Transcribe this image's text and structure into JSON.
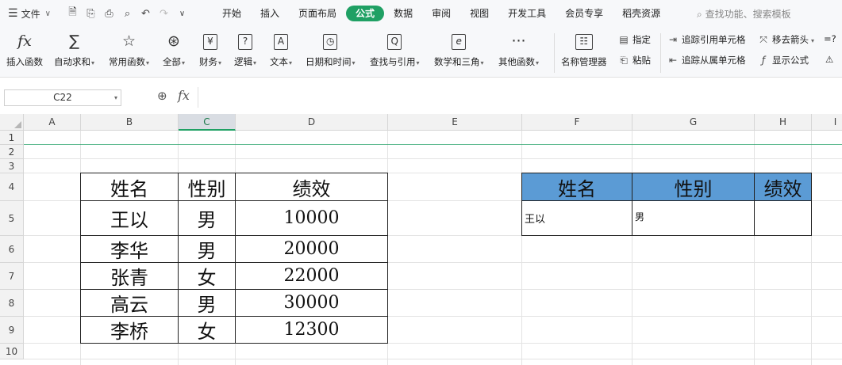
{
  "menubar": {
    "file_label": "文件",
    "tabs": [
      "开始",
      "插入",
      "页面布局",
      "公式",
      "数据",
      "审阅",
      "视图",
      "开发工具",
      "会员专享",
      "稻壳资源"
    ],
    "active_tab": "公式",
    "search_placeholder": "查找功能、搜索模板"
  },
  "ribbon": {
    "insert_function": "插入函数",
    "autosum": "自动求和",
    "common_functions": "常用函数",
    "all": "全部",
    "finance": "财务",
    "logic": "逻辑",
    "text": "文本",
    "datetime": "日期和时间",
    "lookup": "查找与引用",
    "math": "数学和三角",
    "other": "其他函数",
    "name_manager": "名称管理器",
    "define": "指定",
    "paste": "粘贴",
    "trace_precedents": "追踪引用单元格",
    "trace_dependents": "追踪从属单元格",
    "remove_arrows": "移去箭头",
    "show_formulas": "显示公式",
    "icon_fx": "fx",
    "icon_sum": "∑",
    "icon_star": "☆",
    "icon_all": "⊛",
    "icon_yen": "¥",
    "icon_logic": "?",
    "icon_text": "A",
    "icon_clock": "◷",
    "icon_lookup": "Q",
    "icon_math": "e",
    "icon_more": "···"
  },
  "formula_bar": {
    "cell_ref": "C22",
    "formula": ""
  },
  "sheet": {
    "columns": [
      "A",
      "B",
      "C",
      "D",
      "E",
      "F",
      "G",
      "H",
      "I"
    ],
    "selected_column": "C",
    "rows": [
      "1",
      "2",
      "3",
      "4",
      "5",
      "6",
      "7",
      "8",
      "9",
      "10"
    ],
    "table1": {
      "headers": [
        "姓名",
        "性别",
        "绩效"
      ],
      "rows": [
        [
          "王以",
          "男",
          "10000"
        ],
        [
          "李华",
          "男",
          "20000"
        ],
        [
          "张青",
          "女",
          "22000"
        ],
        [
          "高云",
          "男",
          "30000"
        ],
        [
          "李桥",
          "女",
          "12300"
        ]
      ]
    },
    "table2": {
      "headers": [
        "姓名",
        "性别",
        "绩效"
      ],
      "row": [
        "王以",
        "男",
        ""
      ]
    }
  },
  "colors": {
    "accent": "#1fa064",
    "header_fill": "#5b9bd5"
  }
}
